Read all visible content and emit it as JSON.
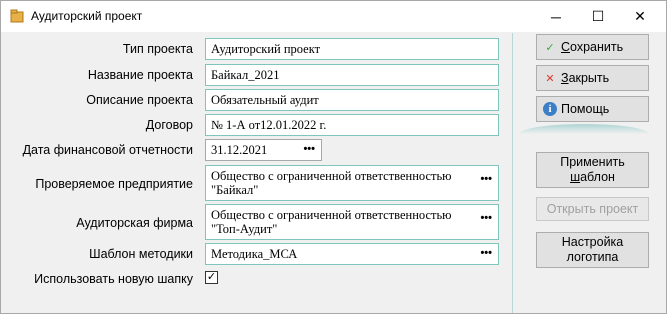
{
  "window": {
    "title": "Аудиторский проект",
    "controls": {
      "minimize": "─",
      "maximize": "☐",
      "close": "✕"
    }
  },
  "form": {
    "project_type": {
      "label": "Тип проекта",
      "value": "Аудиторский проект"
    },
    "project_name": {
      "label": "Название проекта",
      "value": "Байкал_2021"
    },
    "project_description": {
      "label": "Описание проекта",
      "value": "Обязательный аудит"
    },
    "contract": {
      "label": "Договор",
      "value": "№ 1-А от12.01.2022 г."
    },
    "report_date": {
      "label": "Дата финансовой отчетности",
      "value": "31.12.2021"
    },
    "audited_company": {
      "label": "Проверяемое предприятие",
      "line1": "Общество с ограниченной ответственностью",
      "line2": "\"Байкал\""
    },
    "audit_firm": {
      "label": "Аудиторская фирма",
      "line1": "Общество с ограниченной ответственностью",
      "line2": "\"Топ-Аудит\""
    },
    "methodology_template": {
      "label": "Шаблон методики",
      "value": "Методика_МСА"
    },
    "use_new_header": {
      "label": "Использовать новую шапку",
      "checked": true,
      "mark": "✓"
    },
    "ellipsis": "•••"
  },
  "buttons": {
    "save": {
      "pre": "",
      "hot": "С",
      "post": "охранить",
      "icon": "✓",
      "icon_color": "#3aa53a"
    },
    "close": {
      "pre": "",
      "hot": "З",
      "post": "акрыть",
      "icon": "✕",
      "icon_color": "#d93b2b"
    },
    "help": {
      "label": "Помощь",
      "icon": "i",
      "icon_color": "#3c7fc7"
    },
    "apply_template": {
      "pre": "Применить ",
      "hot": "ш",
      "post": "аблон"
    },
    "open_project": {
      "label": "Открыть проект"
    },
    "logo_settings": {
      "line1": "Настройка",
      "line2": "логотипа"
    }
  }
}
